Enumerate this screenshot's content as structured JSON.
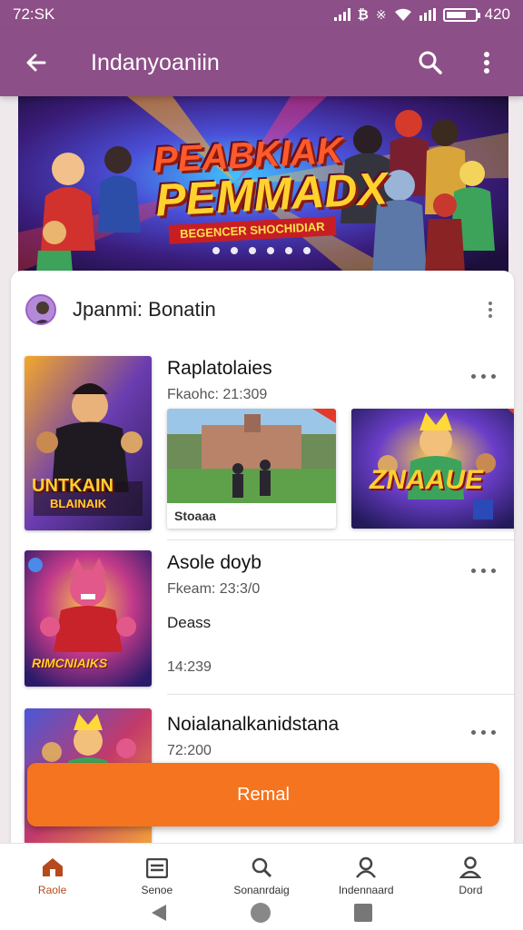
{
  "status_bar": {
    "time": "72:SK",
    "battery_text": "420",
    "battery_level": 0.7
  },
  "app_bar": {
    "title": "Indanyoaniin"
  },
  "banner": {
    "title_line1": "PEABKIAK",
    "title_line2": "PEMMADX",
    "subtitle": "BEGENCER SHOCHIDIAR",
    "dots": 6
  },
  "section": {
    "title": "Jpanmi: Bonatin"
  },
  "items": [
    {
      "title": "Raplatolaies",
      "meta": "Fkaohc: 21:309",
      "thumb_text_1": "UNTKAIN",
      "thumb_text_2": "BLAINAIK",
      "gallery": [
        {
          "caption": "Stoaaa"
        },
        {
          "caption": "ZNAAUE"
        }
      ]
    },
    {
      "title": "Asole doyb",
      "meta": "Fkeam: 23:3/0",
      "badge": "Deass",
      "time": "14:239",
      "thumb_text": "RIMCNIAIKS"
    },
    {
      "title": "Noialanalkanidstana",
      "meta": "72:200"
    }
  ],
  "cta": {
    "label": "Remal"
  },
  "bottom_nav": [
    {
      "label": "Raole",
      "icon": "home-icon"
    },
    {
      "label": "Senoe",
      "icon": "list-icon"
    },
    {
      "label": "Sonanrdaig",
      "icon": "search-icon"
    },
    {
      "label": "Indennaard",
      "icon": "users-icon"
    },
    {
      "label": "Dord",
      "icon": "profile-icon"
    }
  ]
}
